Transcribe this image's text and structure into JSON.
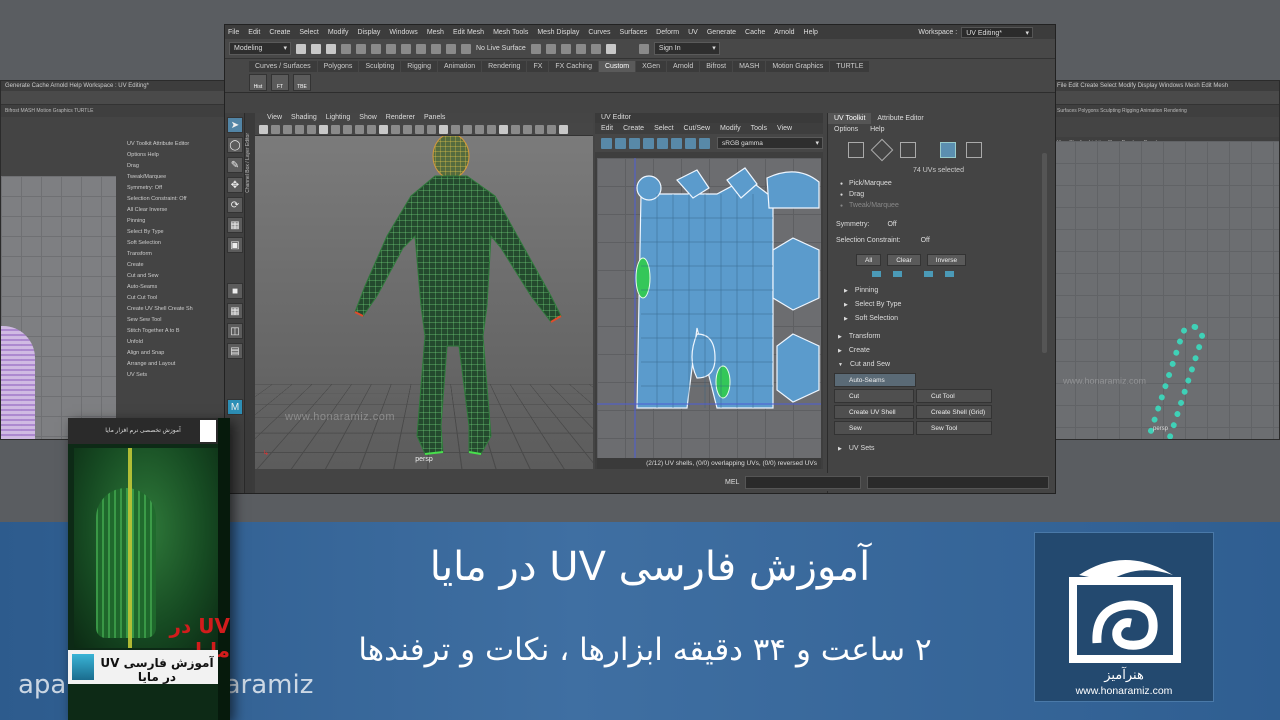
{
  "colors": {
    "banner": "#3f6fa2",
    "accent": "#5285a6",
    "uv_shell": "#4a8ec2",
    "selected_uv": "#34c759"
  },
  "maya": {
    "menubar": [
      "File",
      "Edit",
      "Create",
      "Select",
      "Modify",
      "Display",
      "Windows",
      "Mesh",
      "Edit Mesh",
      "Mesh Tools",
      "Mesh Display",
      "Curves",
      "Surfaces",
      "Deform",
      "UV",
      "Generate",
      "Cache",
      "Arnold",
      "Help"
    ],
    "workspace_label": "Workspace :",
    "workspace_value": "UV Editing*",
    "menuset": "Modeling",
    "live_surface": "No Live Surface",
    "sign_in": "Sign In",
    "shelf_tabs": [
      "Curves / Surfaces",
      "Polygons",
      "Sculpting",
      "Rigging",
      "Animation",
      "Rendering",
      "FX",
      "FX Caching",
      "Custom",
      "XGen",
      "Arnold",
      "Bifrost",
      "MASH",
      "Motion Graphics",
      "TURTLE"
    ],
    "shelf_active": "Custom",
    "shelf_buttons": [
      "Hist",
      "FT",
      "TBE"
    ],
    "layer_strip": "Channel Box / Layer Editor",
    "viewport": {
      "menu": [
        "View",
        "Shading",
        "Lighting",
        "Show",
        "Renderer",
        "Panels"
      ],
      "camera": "persp",
      "watermark": "www.honaramiz.com"
    },
    "uv_editor": {
      "title": "UV Editor",
      "menu": [
        "Edit",
        "Create",
        "Select",
        "Cut/Sew",
        "Modify",
        "Tools",
        "View"
      ],
      "colorspace": "sRGB gamma",
      "status": "(2/12) UV shells, (0/0) overlapping UVs, (0/0) reversed UVs"
    },
    "uv_toolkit": {
      "tabs": [
        "UV Toolkit",
        "Attribute Editor"
      ],
      "menu": [
        "Options",
        "Help"
      ],
      "selected_count": "74 UVs selected",
      "modes": [
        "Pick/Marquee",
        "Drag",
        "Tweak/Marquee"
      ],
      "symmetry_label": "Symmetry:",
      "symmetry_value": "Off",
      "constraint_label": "Selection Constraint:",
      "constraint_value": "Off",
      "buttons": [
        "All",
        "Clear",
        "Inverse"
      ],
      "subsections": [
        "Pinning",
        "Select By Type",
        "Soft Selection"
      ],
      "sections": [
        "Transform",
        "Create",
        "Cut and Sew"
      ],
      "auto_seams": "Auto-Seams",
      "cut": "Cut",
      "cut_tool": "Cut Tool",
      "create_uv_shell": "Create UV Shell",
      "create_shell_grid": "Create Shell (Grid)",
      "sew": "Sew",
      "sew_tool": "Sew Tool",
      "uv_sets": "UV Sets"
    },
    "cmd_label": "MEL"
  },
  "side_left": {
    "menubar": "Generate  Cache  Arnold  Help   Workspace :  UV Editing*",
    "shelf": "Bifrost  MASH  Motion Graphics  TURTLE",
    "colorspace": "sRGB gamma",
    "toolkit_items": [
      "UV Toolkit   Attribute Editor",
      "Options  Help",
      "Drag",
      "Tweak/Marquee",
      "Symmetry:   Off",
      "Selection Constraint:   Off",
      "All   Clear   Inverse",
      "Pinning",
      "Select By Type",
      "Soft Selection",
      "Transform",
      "Create",
      "Cut and Sew",
      "Auto-Seams",
      "Cut        Cut Tool",
      "Create UV Shell   Create Sh",
      "Sew        Sew Tool",
      "Stitch Together   A to B",
      "Unfold",
      "Align and Snap",
      "Arrange and Layout",
      "UV Sets"
    ],
    "cmd": "MEL"
  },
  "side_right": {
    "menubar": "File  Edit  Create  Select  Modify  Display  Windows  Mesh  Edit Mesh",
    "shelf": "Surfaces  Polygons  Sculpting  Rigging  Animation  Rendering",
    "viewport_menu": "View  Shading  Lighting  Show  Renderer  Panels",
    "camera": "persp",
    "watermark": "www.honaramiz.com"
  },
  "banner": {
    "title": "آموزش فارسی UV در مایا",
    "subtitle": "۲ ساعت و ۳۴ دقیقه ابزارها ، نکات و ترفندها",
    "aparat": "aparat.com/honaramiz",
    "logo_fa": "هنرآمیز",
    "logo_url": "www.honaramiz.com"
  },
  "product": {
    "top_text": "آموزش تخصصی نرم افزار مایا",
    "title": "UV در مایا",
    "foot": "آموزش فارسی UV در مایا"
  }
}
